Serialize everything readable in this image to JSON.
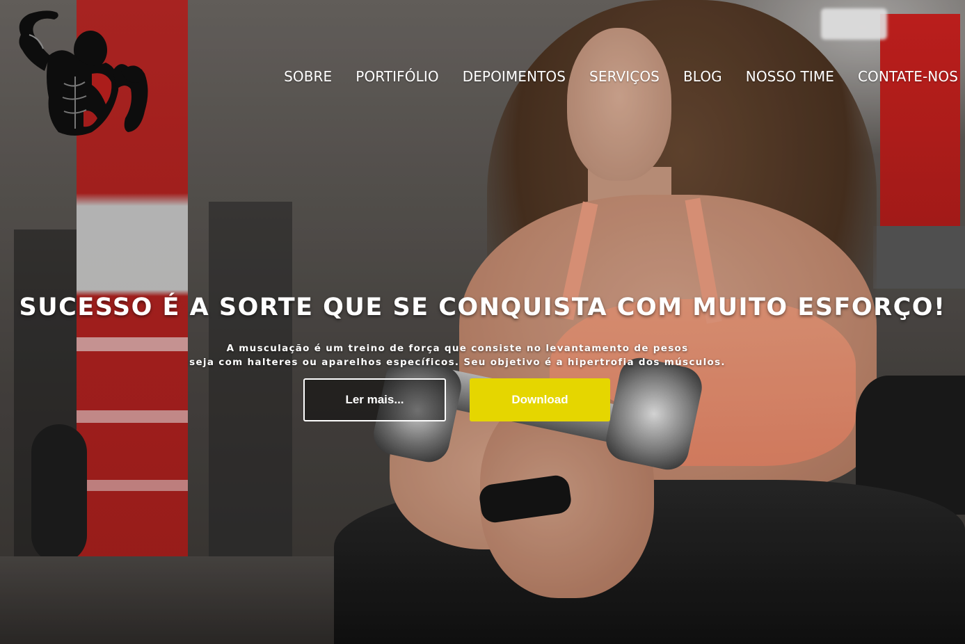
{
  "nav": {
    "items": [
      {
        "label": "SOBRE"
      },
      {
        "label": "PORTIFÓLIO"
      },
      {
        "label": "DEPOIMENTOS"
      },
      {
        "label": "SERVIÇOS"
      },
      {
        "label": "BLOG"
      },
      {
        "label": "NOSSO TIME"
      },
      {
        "label": "CONTATE-NOS"
      }
    ]
  },
  "hero": {
    "headline": "SUCESSO É A SORTE QUE SE CONQUISTA COM MUITO ESFORÇO!",
    "subtext_line1": "A musculação é um treino de força que consiste no levantamento de pesos",
    "subtext_line2": "seja com halteres ou aparelhos específicos.  Seu objetivo é a hipertrofia dos músculos.",
    "read_more_label": "Ler mais...",
    "download_label": "Download"
  },
  "colors": {
    "accent_button": "#e5d600",
    "logo_red": "#c8211f"
  },
  "icons": {
    "logo": "bodybuilder-logo-icon"
  }
}
